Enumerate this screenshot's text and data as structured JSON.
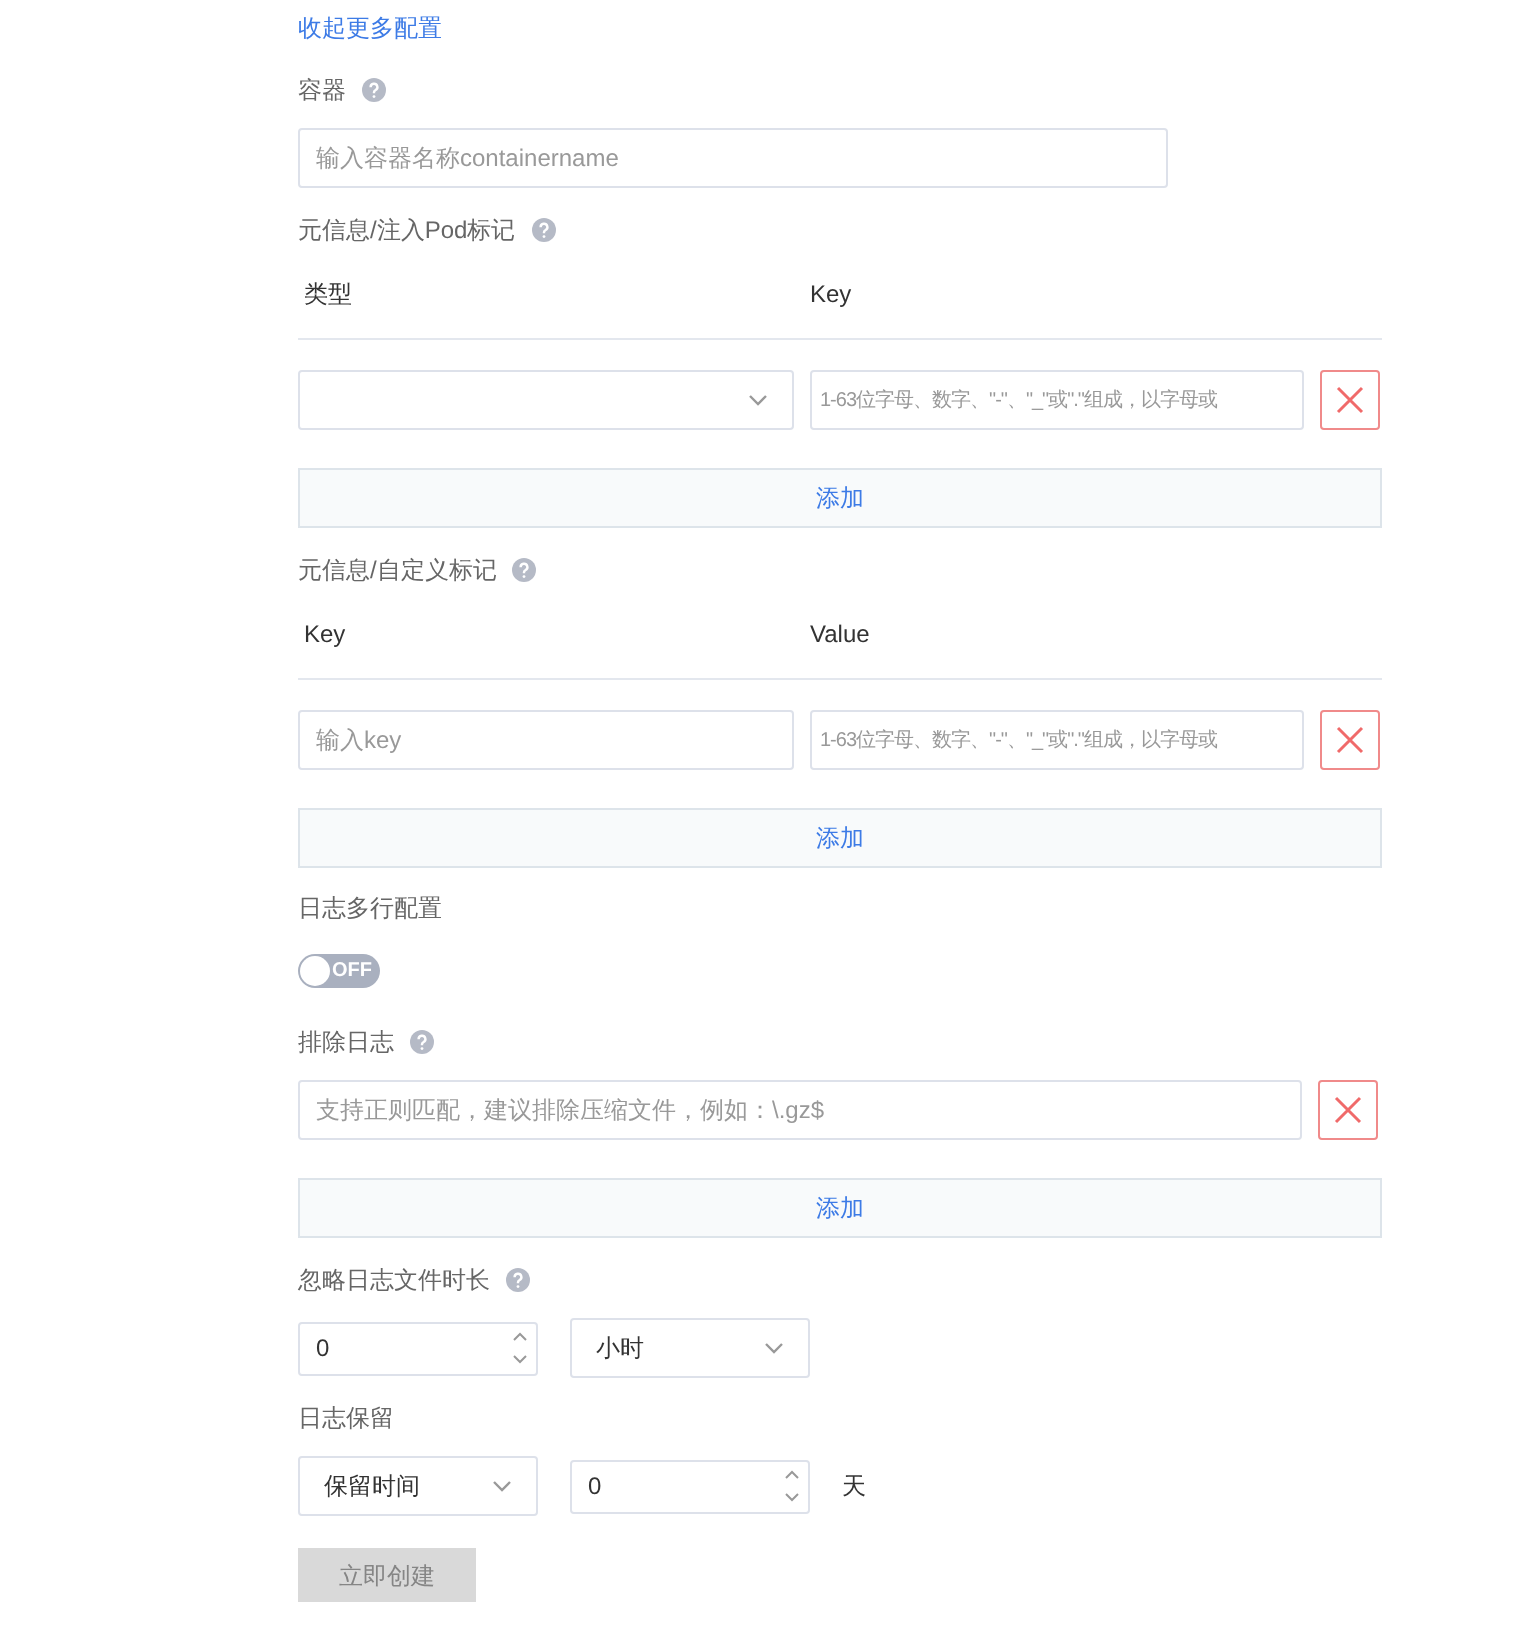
{
  "collapse_link": "收起更多配置",
  "container": {
    "label": "容器",
    "placeholder": "输入容器名称containername"
  },
  "pod_labels": {
    "label": "元信息/注入Pod标记",
    "columns": [
      "类型",
      "Key"
    ],
    "rows": [
      {
        "key_placeholder": "1-63位字母、数字、\"-\"、\"_\"或\".\"组成，以字母或"
      }
    ],
    "add_button": "添加"
  },
  "custom_labels": {
    "label": "元信息/自定义标记",
    "columns": [
      "Key",
      "Value"
    ],
    "rows": [
      {
        "key_placeholder": "输入key",
        "value_placeholder": "1-63位字母、数字、\"-\"、\"_\"或\".\"组成，以字母或"
      }
    ],
    "add_button": "添加"
  },
  "multiline": {
    "label": "日志多行配置",
    "toggle": {
      "on": false,
      "text": "OFF"
    }
  },
  "exclude": {
    "label": "排除日志",
    "rows": [
      {
        "placeholder": "支持正则匹配，建议排除压缩文件，例如：\\.gz$"
      }
    ],
    "add_button": "添加"
  },
  "ignore_age": {
    "label": "忽略日志文件时长",
    "value": "0",
    "unit": "小时"
  },
  "retention": {
    "label": "日志保留",
    "mode": "保留时间",
    "value": "0",
    "unit": "天"
  },
  "submit": {
    "label": "立即创建",
    "disabled": true
  }
}
